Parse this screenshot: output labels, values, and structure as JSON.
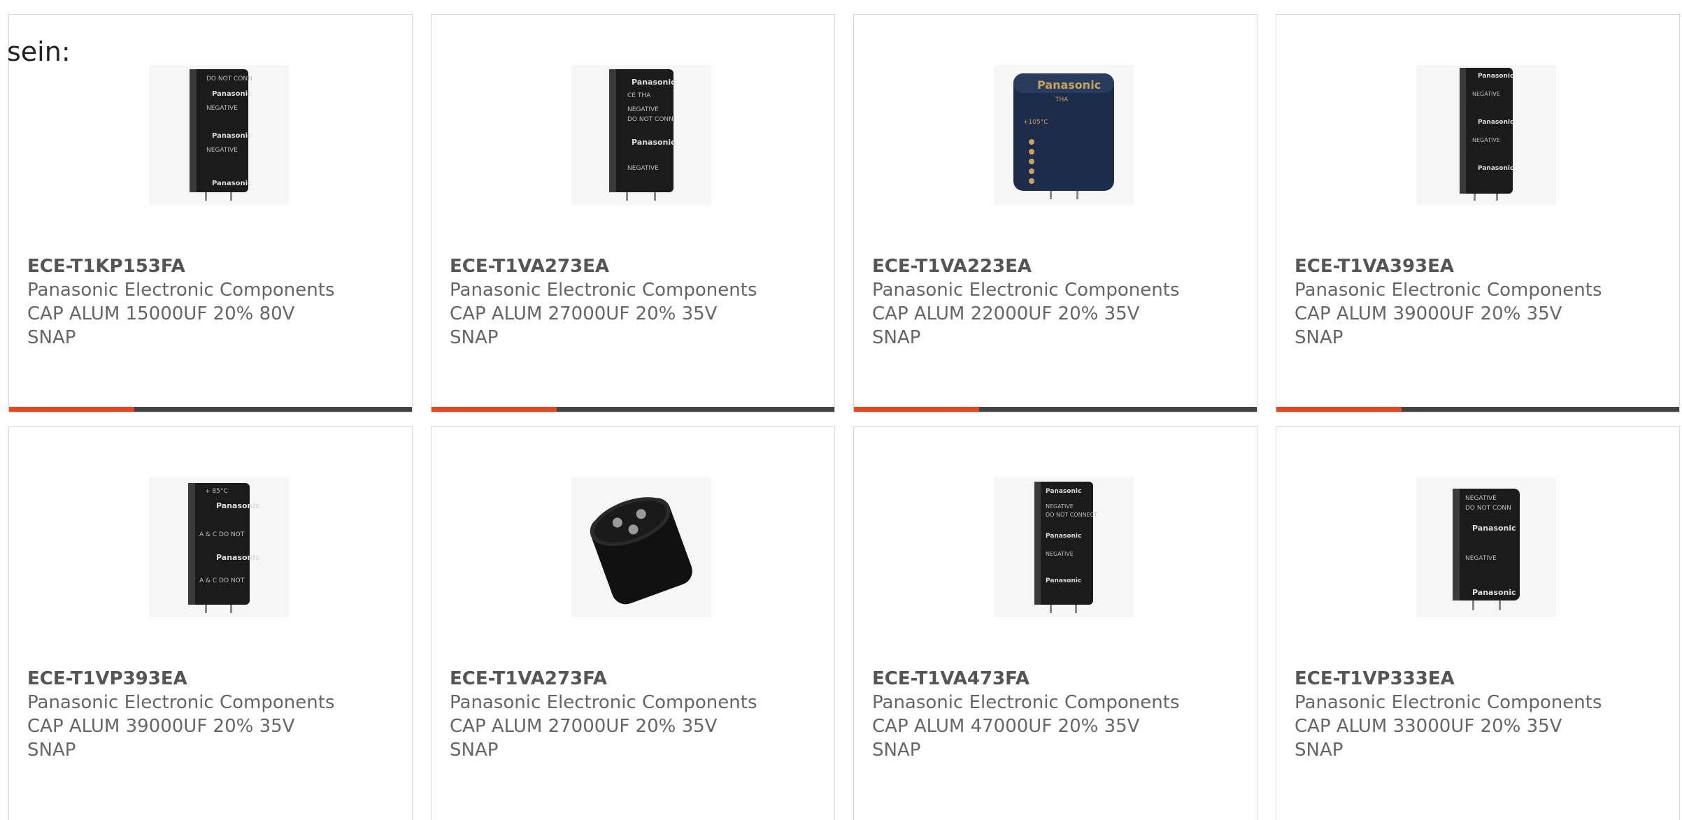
{
  "intro_text": "sein:",
  "accent_color": "#e8461e",
  "bar_track_color": "#444444",
  "products": [
    {
      "part_number": "ECE-T1KP153FA",
      "manufacturer": "Panasonic Electronic Components",
      "description_line1": "CAP ALUM 15000UF 20% 80V",
      "description_line2": "SNAP",
      "image_icon": "capacitor-snap-in-tall-icon",
      "progress_fraction": 0.31
    },
    {
      "part_number": "ECE-T1VA273EA",
      "manufacturer": "Panasonic Electronic Components",
      "description_line1": "CAP ALUM 27000UF 20% 35V",
      "description_line2": "SNAP",
      "image_icon": "capacitor-snap-in-tall-icon",
      "progress_fraction": 0.31
    },
    {
      "part_number": "ECE-T1VA223EA",
      "manufacturer": "Panasonic Electronic Components",
      "description_line1": "CAP ALUM 22000UF 20% 35V",
      "description_line2": "SNAP",
      "image_icon": "capacitor-snap-in-wide-blue-icon",
      "progress_fraction": 0.31
    },
    {
      "part_number": "ECE-T1VA393EA",
      "manufacturer": "Panasonic Electronic Components",
      "description_line1": "CAP ALUM 39000UF 20% 35V",
      "description_line2": "SNAP",
      "image_icon": "capacitor-snap-in-tall-icon",
      "progress_fraction": 0.31
    },
    {
      "part_number": "ECE-T1VP393EA",
      "manufacturer": "Panasonic Electronic Components",
      "description_line1": "CAP ALUM 39000UF 20% 35V",
      "description_line2": "SNAP",
      "image_icon": "capacitor-snap-in-tall-icon"
    },
    {
      "part_number": "ECE-T1VA273FA",
      "manufacturer": "Panasonic Electronic Components",
      "description_line1": "CAP ALUM 27000UF 20% 35V",
      "description_line2": "SNAP",
      "image_icon": "capacitor-bottom-view-icon"
    },
    {
      "part_number": "ECE-T1VA473FA",
      "manufacturer": "Panasonic Electronic Components",
      "description_line1": "CAP ALUM 47000UF 20% 35V",
      "description_line2": "SNAP",
      "image_icon": "capacitor-snap-in-tall-icon"
    },
    {
      "part_number": "ECE-T1VP333EA",
      "manufacturer": "Panasonic Electronic Components",
      "description_line1": "CAP ALUM 33000UF 20% 35V",
      "description_line2": "SNAP",
      "image_icon": "capacitor-snap-in-tall-icon"
    }
  ]
}
